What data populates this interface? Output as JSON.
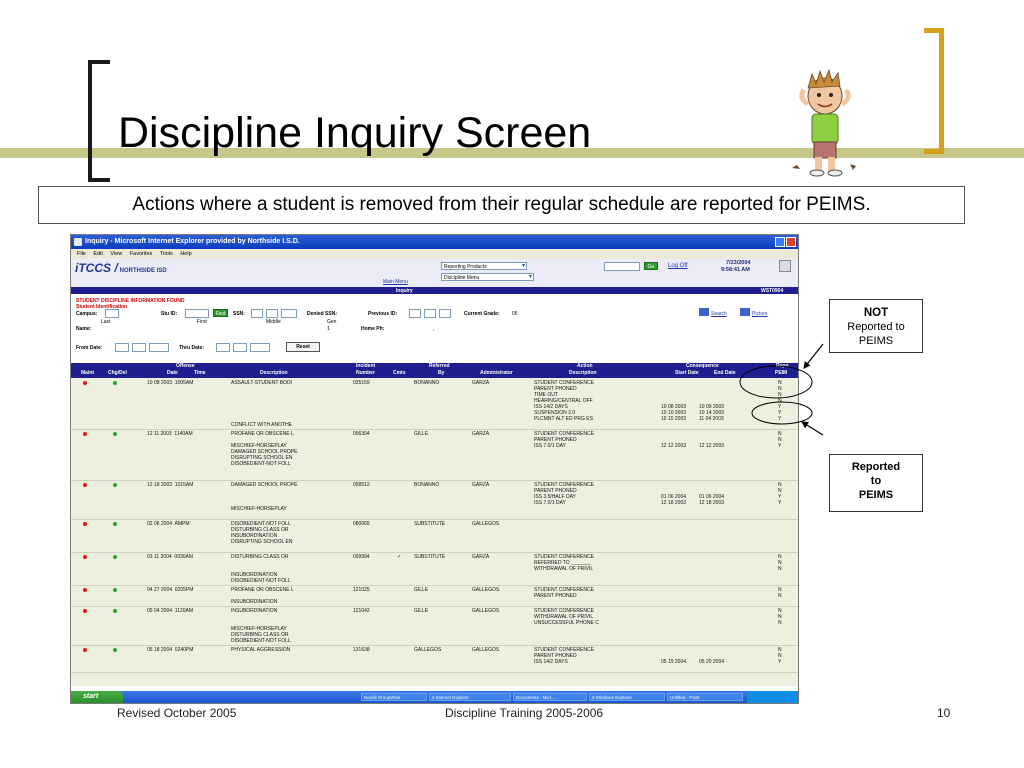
{
  "slide": {
    "title": "Discipline Inquiry Screen",
    "subtitle": "Actions where a student is removed from their regular schedule are reported for PEIMS.",
    "callout_not": {
      "bold": "NOT",
      "line2": "Reported to",
      "line3": "PEIMS"
    },
    "callout_reported": {
      "line1": "Reported",
      "line2": "to",
      "line3": "PEIMS"
    },
    "footer": {
      "left": "Revised October 2005",
      "center": "Discipline Training 2005-2006",
      "page": "10"
    },
    "colors": {
      "accent_bar": "#c8c78a",
      "bracket_right": "#d69f1a",
      "bracket_left": "#1a1a1a"
    }
  },
  "browser": {
    "window_title": "Inquiry - Microsoft Internet Explorer provided by Northside I.S.D.",
    "menu": [
      "File",
      "Edit",
      "View",
      "Favorites",
      "Tools",
      "Help"
    ],
    "app": {
      "logo": "iTCCS /",
      "district": "NORTHSIDE ISD",
      "reporting_select": "Reporting Products",
      "discipline_select": "Discipline Menu",
      "go": "Go",
      "logoff": "Log Off",
      "date": "7/23/2004",
      "time": "9:58:41 AM",
      "main_menu": "Main Menu",
      "page_name": "Inquiry",
      "screen_code": "WST0904"
    },
    "form": {
      "found_msg": "STUDENT DISCIPLINE INFORMATION FOUND",
      "student_ident": "Student Identification",
      "campus": "Campus:",
      "stu_id": "Stu ID:",
      "find": "Find",
      "ssn": "SSN:",
      "denied_ssn": "Denied SSN:",
      "previous_id": "Previous ID:",
      "current_grade": "Current Grade:",
      "grade_value": "05",
      "search": "Search",
      "picture": "Picture",
      "last": "Last",
      "first": "First",
      "middle": "Middle",
      "gen": "Gen",
      "gen_value": "1",
      "name": "Name:",
      "home_ph": "Home Ph:",
      "home_ph_value": ",",
      "from_date": "From Date:",
      "thru_date": "Thru Date:",
      "reset": "Reset"
    },
    "grid_headers": {
      "maint": "Maint",
      "chg_del": "Chg/Del",
      "offense": "Offense",
      "date": "Date",
      "time": "Time",
      "description": "Description",
      "incident": "Incident",
      "number": "Number",
      "cmts": "Cmts",
      "referred": "Referred",
      "by": "By",
      "administrator": "Administrator",
      "action": "Action",
      "action_desc": "Description",
      "consequence": "Consequence",
      "start_date": "Start Date",
      "end_date": "End Date",
      "repo": "Repo",
      "peims": "PEIM"
    },
    "rows": [
      {
        "datetime": "10 08 2003  1005AM",
        "desc": [
          "ASSAULT-STUDENT BODI"
        ],
        "desc2": [
          "CONFLICT WITH ANOTHE"
        ],
        "incident": "025159",
        "cmt": "",
        "by": "BONANNO",
        "admin": "GARZA",
        "actions": [
          "STUDENT CONFERENCE",
          "PARENT PHONED",
          "TIME OUT",
          "HEARING/CENTRAL OFF",
          "ISS 14/2 DAYS",
          "SUSPENSION 2.0",
          "PLCMNT ALT ED PRG ES"
        ],
        "starts": [
          "",
          "",
          "",
          "",
          "10 08 2003",
          "10 10 2003",
          "10 15 2003"
        ],
        "ends": [
          "",
          "",
          "",
          "",
          "10 09 2003",
          "10 14 2003",
          "11 04 2003"
        ],
        "peims": [
          "N",
          "N",
          "N",
          "N",
          "Y",
          "Y",
          "Y"
        ]
      },
      {
        "datetime": "12 11 2003  1140AM",
        "desc": [
          "PROFANE OR OBSCENE L",
          "",
          "MISCHIEF-HORSEPLAY",
          "DAMAGED SCHOOL PROPE",
          "DISRUPTING SCHOOL EN",
          "DISOBEDIENT-NOT FOLL"
        ],
        "desc2": [],
        "incident": "056304",
        "cmt": "",
        "by": "GILLE",
        "admin": "GARZA",
        "actions": [
          "STUDENT CONFERENCE",
          "PARENT PHONED",
          "ISS 7.0/1 DAY"
        ],
        "starts": [
          "",
          "",
          "12 12 2003"
        ],
        "ends": [
          "",
          "",
          "12 12 2003"
        ],
        "peims": [
          "N",
          "N",
          "Y"
        ]
      },
      {
        "datetime": "12 18 2003  1015AM",
        "desc": [
          "DAMAGED SCHOOL PROPE",
          "",
          "",
          "",
          "MISCHIEF-HORSEPLAY"
        ],
        "desc2": [],
        "incident": "058512",
        "cmt": "",
        "by": "BONANNO",
        "admin": "GARZA",
        "actions": [
          "STUDENT CONFERENCE",
          "PARENT PHONED",
          "ISS 3.5/HALF DAY",
          "ISS 7.0/1 DAY"
        ],
        "starts": [
          "",
          "",
          "01 06 2004",
          "12 18 2003"
        ],
        "ends": [
          "",
          "",
          "01 06 2004",
          "12 18 2003"
        ],
        "peims": [
          "N",
          "N",
          "Y",
          "Y"
        ]
      },
      {
        "datetime": "02 06 2004  AMPM",
        "desc": [
          "DISOBEDIENT-NOT FOLL",
          "DISTURBING CLASS OR",
          "INSUBORDINATION",
          "DISRUPTING SCHOOL EN"
        ],
        "desc2": [],
        "incident": "080065",
        "cmt": "",
        "by": "SUBSTITUTE",
        "admin": "GALLEGOS",
        "actions": [],
        "starts": [],
        "ends": [],
        "peims": []
      },
      {
        "datetime": "03 11 2004  0930AM",
        "desc": [
          "DISTURBING CLASS OR",
          "",
          "",
          "INSUBORDINATION",
          "DISOBEDIENT-NOT FOLL"
        ],
        "desc2": [],
        "incident": "099994",
        "cmt": "✓",
        "by": "SUBSTITUTE",
        "admin": "GARZA",
        "actions": [
          "STUDENT CONFERENCE",
          "REFERRED TO _______",
          "WITHDRAWAL OF PRIVIL"
        ],
        "starts": [
          "",
          "",
          ""
        ],
        "ends": [
          "",
          "",
          ""
        ],
        "peims": [
          "N",
          "N",
          "N"
        ]
      },
      {
        "datetime": "04 27 2004  0205PM",
        "desc": [
          "PROFANE OR OBSCENE L",
          "",
          "INSUBORDINATION"
        ],
        "desc2": [],
        "incident": "121025",
        "cmt": "",
        "by": "GILLE",
        "admin": "GALLEGOS",
        "actions": [
          "STUDENT CONFERENCE",
          "PARENT PHONED"
        ],
        "starts": [
          "",
          ""
        ],
        "ends": [
          "",
          ""
        ],
        "peims": [
          "N",
          "N"
        ]
      },
      {
        "datetime": "05 04 2004  1120AM",
        "desc": [
          "INSUBORDINATION",
          "",
          "",
          "MISCHIEF-HORSEPLAY",
          "DISTURBING CLASS OR",
          "DISOBEDIENT-NOT FOLL"
        ],
        "desc2": [],
        "incident": "121042",
        "cmt": "",
        "by": "GILLE",
        "admin": "GALLEGOS",
        "actions": [
          "STUDENT CONFERENCE",
          "WITHDRAWAL OF PRIVIL",
          "UNSUCCESSFUL PHONE C"
        ],
        "starts": [
          "",
          "",
          ""
        ],
        "ends": [
          "",
          "",
          ""
        ],
        "peims": [
          "N",
          "N",
          "N"
        ]
      },
      {
        "datetime": "05 18 2004  0240PM",
        "desc": [
          "PHYSICAL AGGRESSION"
        ],
        "desc2": [],
        "incident": "131638",
        "cmt": "",
        "by": "GALLEGOS",
        "admin": "GALLEGOS",
        "actions": [
          "STUDENT CONFERENCE",
          "PARENT PHONED",
          "ISS 14/2 DAYS"
        ],
        "starts": [
          "",
          "",
          "05 19 2004"
        ],
        "ends": [
          "",
          "",
          "05 20 2004"
        ],
        "peims": [
          "N",
          "N",
          "Y"
        ]
      }
    ],
    "taskbar": {
      "start": "start",
      "items": [
        "Novell GroupWise",
        "2 Internet Explorer",
        "Documents - Micr...",
        "2 Windows Explorer",
        "Untitled - Paint"
      ]
    }
  }
}
